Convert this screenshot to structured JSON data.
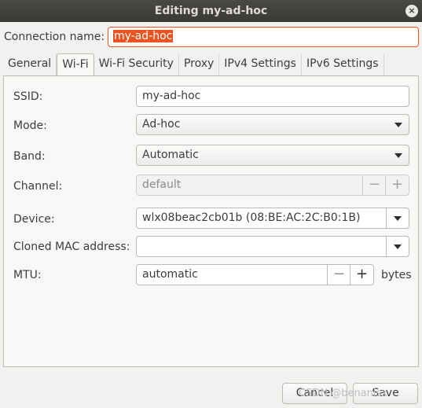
{
  "window": {
    "title": "Editing my-ad-hoc",
    "close_glyph": "×"
  },
  "connection_name": {
    "label": "Connection name:",
    "value": "my-ad-hoc"
  },
  "tabs": [
    {
      "label": "General"
    },
    {
      "label": "Wi-Fi",
      "active": true
    },
    {
      "label": "Wi-Fi Security"
    },
    {
      "label": "Proxy"
    },
    {
      "label": "IPv4 Settings"
    },
    {
      "label": "IPv6 Settings"
    }
  ],
  "wifi": {
    "ssid": {
      "label": "SSID:",
      "value": "my-ad-hoc"
    },
    "mode": {
      "label": "Mode:",
      "value": "Ad-hoc"
    },
    "band": {
      "label": "Band:",
      "value": "Automatic"
    },
    "channel": {
      "label": "Channel:",
      "value": "default"
    },
    "device": {
      "label": "Device:",
      "value": "wlx08beac2cb01b (08:BE:AC:2C:B0:1B)"
    },
    "cloned_mac": {
      "label": "Cloned MAC address:",
      "value": ""
    },
    "mtu": {
      "label": "MTU:",
      "value": "automatic",
      "unit": "bytes"
    }
  },
  "stepper": {
    "minus": "−",
    "plus": "+"
  },
  "buttons": {
    "cancel": "Cancel",
    "save": "Save"
  },
  "watermark": "CSDN @benanisx"
}
